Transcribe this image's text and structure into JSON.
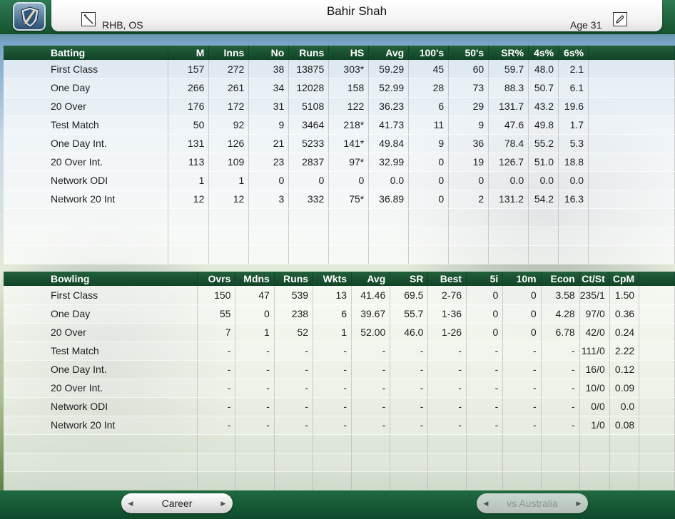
{
  "header": {
    "player_name": "Bahir Shah",
    "player_style": "RHB, OS",
    "age": "Age 31",
    "logo_icon": "cricket-bat-shield-icon",
    "edit_icon": "pencil-icon"
  },
  "batting": {
    "headers": [
      "Batting",
      "M",
      "Inns",
      "No",
      "Runs",
      "HS",
      "Avg",
      "100's",
      "50's",
      "SR%",
      "4s%",
      "6s%"
    ],
    "rows": [
      [
        "First Class",
        "157",
        "272",
        "38",
        "13875",
        "303*",
        "59.29",
        "45",
        "60",
        "59.7",
        "48.0",
        "2.1"
      ],
      [
        "One Day",
        "266",
        "261",
        "34",
        "12028",
        "158",
        "52.99",
        "28",
        "73",
        "88.3",
        "50.7",
        "6.1"
      ],
      [
        "20 Over",
        "176",
        "172",
        "31",
        "5108",
        "122",
        "36.23",
        "6",
        "29",
        "131.7",
        "43.2",
        "19.6"
      ],
      [
        "Test Match",
        "50",
        "92",
        "9",
        "3464",
        "218*",
        "41.73",
        "11",
        "9",
        "47.6",
        "49.8",
        "1.7"
      ],
      [
        "One Day Int.",
        "131",
        "126",
        "21",
        "5233",
        "141*",
        "49.84",
        "9",
        "36",
        "78.4",
        "55.2",
        "5.3"
      ],
      [
        "20 Over Int.",
        "113",
        "109",
        "23",
        "2837",
        "97*",
        "32.99",
        "0",
        "19",
        "126.7",
        "51.0",
        "18.8"
      ],
      [
        "Network ODI",
        "1",
        "1",
        "0",
        "0",
        "0",
        "0.0",
        "0",
        "0",
        "0.0",
        "0.0",
        "0.0"
      ],
      [
        "Network 20 Int",
        "12",
        "12",
        "3",
        "332",
        "75*",
        "36.89",
        "0",
        "2",
        "131.2",
        "54.2",
        "16.3"
      ]
    ]
  },
  "bowling": {
    "headers": [
      "Bowling",
      "Ovrs",
      "Mdns",
      "Runs",
      "Wkts",
      "Avg",
      "SR",
      "Best",
      "5i",
      "10m",
      "Econ",
      "Ct/St",
      "CpM"
    ],
    "rows": [
      [
        "First Class",
        "150",
        "47",
        "539",
        "13",
        "41.46",
        "69.5",
        "2-76",
        "0",
        "0",
        "3.58",
        "235/1",
        "1.50"
      ],
      [
        "One Day",
        "55",
        "0",
        "238",
        "6",
        "39.67",
        "55.7",
        "1-36",
        "0",
        "0",
        "4.28",
        "97/0",
        "0.36"
      ],
      [
        "20 Over",
        "7",
        "1",
        "52",
        "1",
        "52.00",
        "46.0",
        "1-26",
        "0",
        "0",
        "6.78",
        "42/0",
        "0.24"
      ],
      [
        "Test Match",
        "-",
        "-",
        "-",
        "-",
        "-",
        "-",
        "-",
        "-",
        "-",
        "-",
        "111/0",
        "2.22"
      ],
      [
        "One Day Int.",
        "-",
        "-",
        "-",
        "-",
        "-",
        "-",
        "-",
        "-",
        "-",
        "-",
        "16/0",
        "0.12"
      ],
      [
        "20 Over Int.",
        "-",
        "-",
        "-",
        "-",
        "-",
        "-",
        "-",
        "-",
        "-",
        "-",
        "10/0",
        "0.09"
      ],
      [
        "Network ODI",
        "-",
        "-",
        "-",
        "-",
        "-",
        "-",
        "-",
        "-",
        "-",
        "-",
        "0/0",
        "0.0"
      ],
      [
        "Network 20 Int",
        "-",
        "-",
        "-",
        "-",
        "-",
        "-",
        "-",
        "-",
        "-",
        "-",
        "1/0",
        "0.08"
      ]
    ]
  },
  "footer": {
    "tab_career": "Career",
    "tab_vs": "vs Australia",
    "arrow_left_icon": "chevron-left-icon",
    "arrow_right_icon": "chevron-right-icon"
  }
}
